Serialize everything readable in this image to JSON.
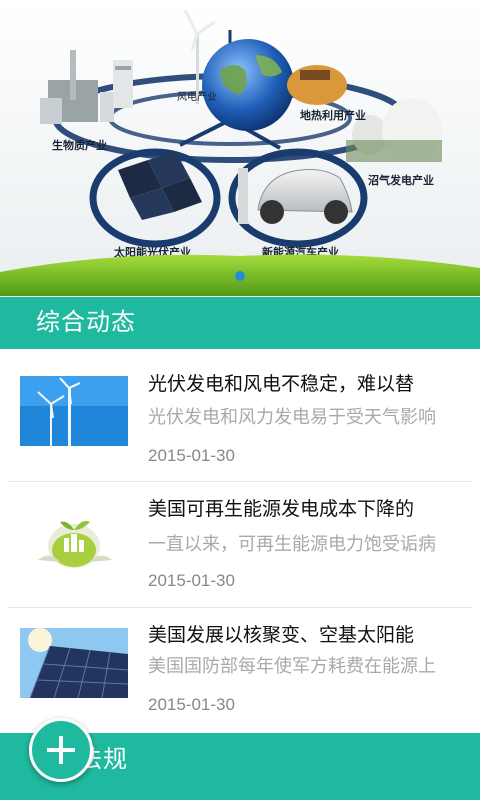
{
  "banner": {
    "labels": {
      "wind": "风电产业",
      "geothermal": "地热利用产业",
      "biomass": "生物质产业",
      "biogas": "沼气发电产业",
      "solar": "太阳能光伏产业",
      "ev": "新能源汽车产业"
    },
    "pager": {
      "count": 1,
      "active_index": 0
    }
  },
  "sections": [
    {
      "title": "综合动态"
    },
    {
      "title": "法规"
    }
  ],
  "news": [
    {
      "headline": "光伏发电和风电不稳定，难以替",
      "summary": "光伏发电和风力发电易于受天气影响",
      "date": "2015-01-30",
      "thumb_icon": "wind-turbine-image"
    },
    {
      "headline": "美国可再生能源发电成本下降的",
      "summary": "一直以来，可再生能源电力饱受诟病",
      "date": "2015-01-30",
      "thumb_icon": "green-city-eggshell-image"
    },
    {
      "headline": "美国发展以核聚变、空基太阳能",
      "summary": "美国国防部每年使军方耗费在能源上",
      "date": "2015-01-30",
      "thumb_icon": "solar-panel-image"
    }
  ],
  "colors": {
    "accent": "#1fb99f",
    "background": "#f3f4f4"
  }
}
